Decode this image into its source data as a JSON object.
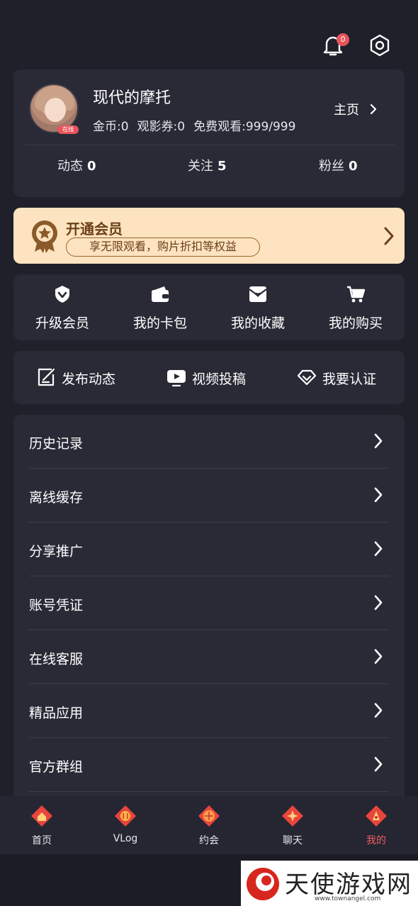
{
  "header": {
    "notification_count": "0"
  },
  "profile": {
    "username": "现代的摩托",
    "online_badge": "在线",
    "coins": "金币:0",
    "tickets": "观影券:0",
    "free_views": "免费观看:999/999",
    "homepage_label": "主页",
    "counts": [
      {
        "label": "动态",
        "value": "0"
      },
      {
        "label": "关注",
        "value": "5"
      },
      {
        "label": "粉丝",
        "value": "0"
      }
    ]
  },
  "vip": {
    "title": "开通会员",
    "subtitle": "享无限观看，购片折扣等权益"
  },
  "quick_actions": [
    {
      "label": "升级会员",
      "icon": "vip-shield-icon"
    },
    {
      "label": "我的卡包",
      "icon": "wallet-icon"
    },
    {
      "label": "我的收藏",
      "icon": "favorite-box-icon"
    },
    {
      "label": "我的购买",
      "icon": "cart-icon"
    }
  ],
  "creator_actions": [
    {
      "label": "发布动态",
      "icon": "edit-icon"
    },
    {
      "label": "视频投稿",
      "icon": "video-upload-icon"
    },
    {
      "label": "我要认证",
      "icon": "diamond-icon"
    }
  ],
  "menu": [
    {
      "label": "历史记录"
    },
    {
      "label": "离线缓存"
    },
    {
      "label": "分享推广"
    },
    {
      "label": "账号凭证"
    },
    {
      "label": "在线客服"
    },
    {
      "label": "精品应用"
    },
    {
      "label": "官方群组"
    }
  ],
  "tabs": [
    {
      "label": "首页",
      "active": false
    },
    {
      "label": "VLog",
      "active": false
    },
    {
      "label": "约会",
      "active": false
    },
    {
      "label": "聊天",
      "active": false
    },
    {
      "label": "我的",
      "active": true
    }
  ],
  "watermark": {
    "text": "天使游戏网",
    "url": "www.townangel.com"
  },
  "colors": {
    "accent": "#f05c63",
    "vip_bg": "#fde3bf",
    "vip_text": "#6a3f18",
    "card": "#292a36",
    "background": "#1f2029"
  }
}
